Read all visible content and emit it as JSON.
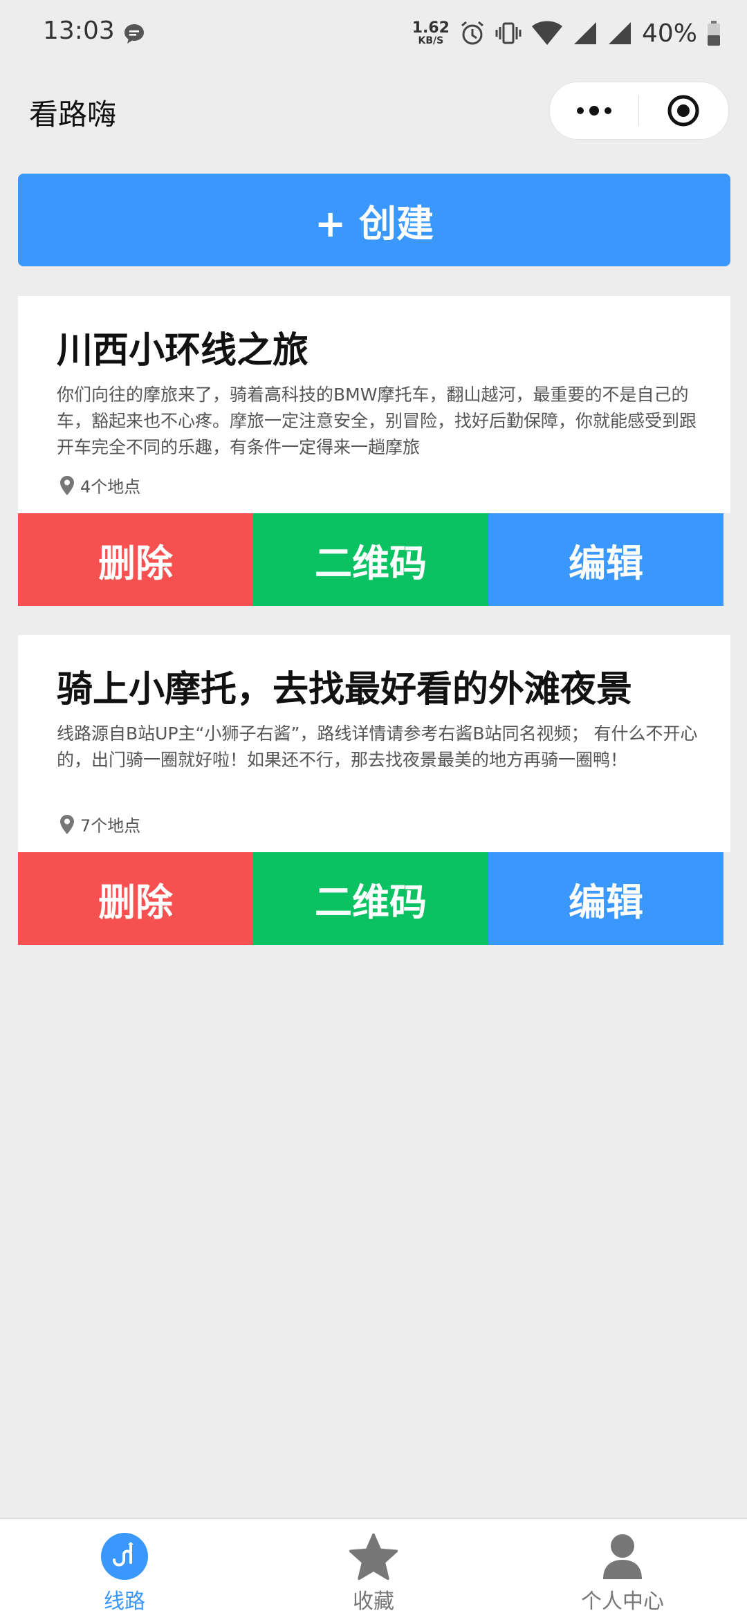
{
  "status_bar": {
    "time": "13:03",
    "speed_value": "1.62",
    "speed_unit": "KB/S",
    "battery": "40%"
  },
  "nav": {
    "title": "看路嗨"
  },
  "create_button_label": "+ 创建",
  "routes": [
    {
      "title": "川西小环线之旅",
      "description": "你们向往的摩旅来了，骑着高科技的BMW摩托车，翻山越河，最重要的不是自己的车，豁起来也不心疼。摩旅一定注意安全，别冒险，找好后勤保障，你就能感受到跟开车完全不同的乐趣，有条件一定得来一趟摩旅",
      "locations": "4个地点",
      "delete_label": "删除",
      "qr_label": "二维码",
      "edit_label": "编辑"
    },
    {
      "title": "骑上小摩托，去找最好看的外滩夜景",
      "description": "线路源自B站UP主“小狮子右酱”，路线详情请参考右酱B站同名视频； 有什么不开心的，出门骑一圈就好啦！如果还不行，那去找夜景最美的地方再骑一圈鸭！",
      "locations": "7个地点",
      "delete_label": "删除",
      "qr_label": "二维码",
      "edit_label": "编辑"
    }
  ],
  "tabs": [
    {
      "label": "线路",
      "icon": "route-icon",
      "active": true
    },
    {
      "label": "收藏",
      "icon": "star-icon",
      "active": false
    },
    {
      "label": "个人中心",
      "icon": "person-icon",
      "active": false
    }
  ],
  "colors": {
    "primary": "#3a98fc",
    "delete": "#f75050",
    "qr": "#0ac262",
    "background": "#ededed"
  }
}
